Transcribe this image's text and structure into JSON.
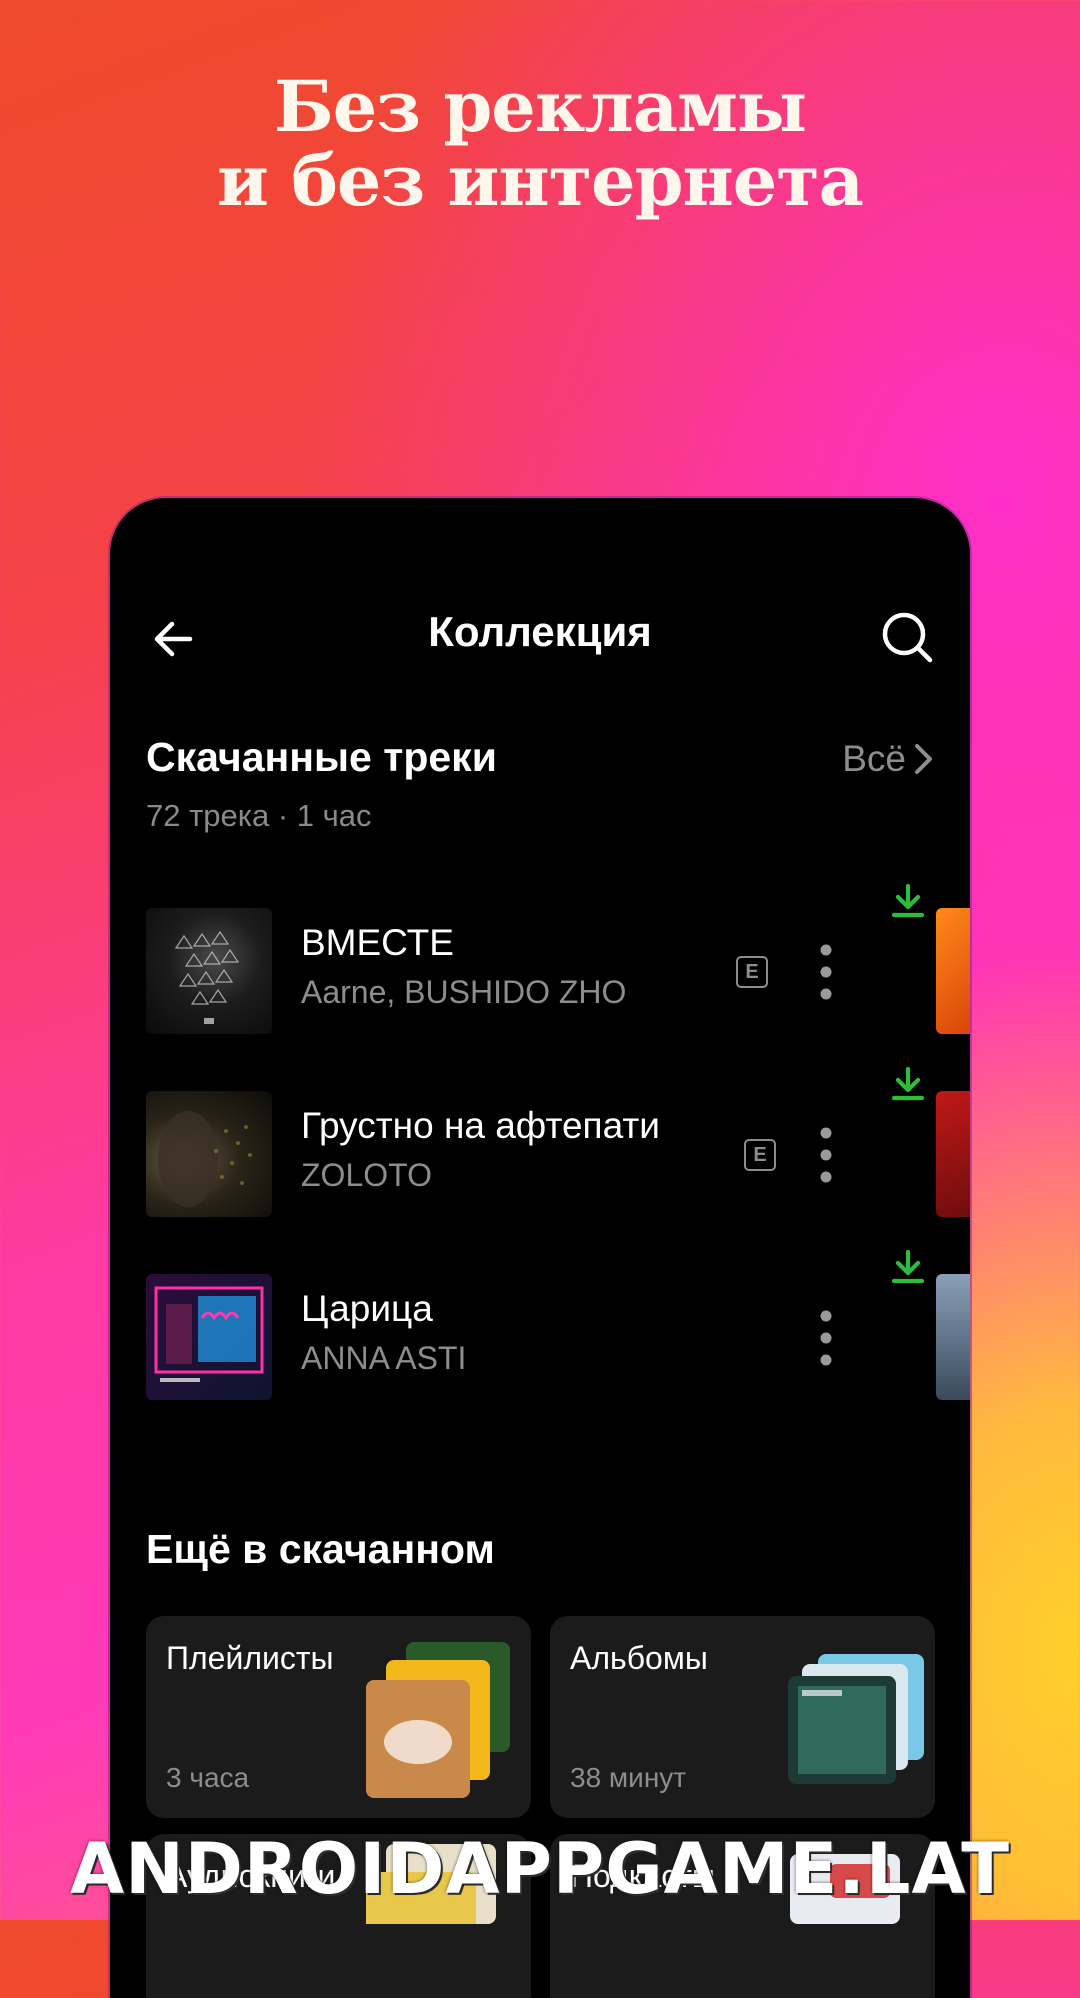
{
  "headline": {
    "line1": "Без рекламы",
    "line2": "и без интернета"
  },
  "header": {
    "title": "Коллекция",
    "back_icon": "arrow-left-icon",
    "search_icon": "search-icon"
  },
  "downloads": {
    "title": "Скачанные треки",
    "subtitle": "72 трека · 1 час",
    "see_all": "Всё"
  },
  "tracks": [
    {
      "title": "ВМЕСТЕ",
      "artist": "Aarne, BUSHIDO ZHO",
      "explicit": true,
      "explicit_label": "E"
    },
    {
      "title": "Грустно на афтепати",
      "artist": "ZOLOTO",
      "explicit": true,
      "explicit_label": "E"
    },
    {
      "title": "Царица",
      "artist": "ANNA ASTI",
      "explicit": false
    }
  ],
  "more": {
    "title": "Ещё в скачанном",
    "cards": [
      {
        "title": "Плейлисты",
        "subtitle": "3 часа"
      },
      {
        "title": "Альбомы",
        "subtitle": "38 минут"
      },
      {
        "title": "Аудиокниги"
      },
      {
        "title": "Подкасты"
      }
    ]
  },
  "watermark": "ANDROIDAPPGAME.LAT",
  "colors": {
    "download_green": "#2ebd3a",
    "background": "#000000",
    "muted_text": "#8d8d8d"
  }
}
